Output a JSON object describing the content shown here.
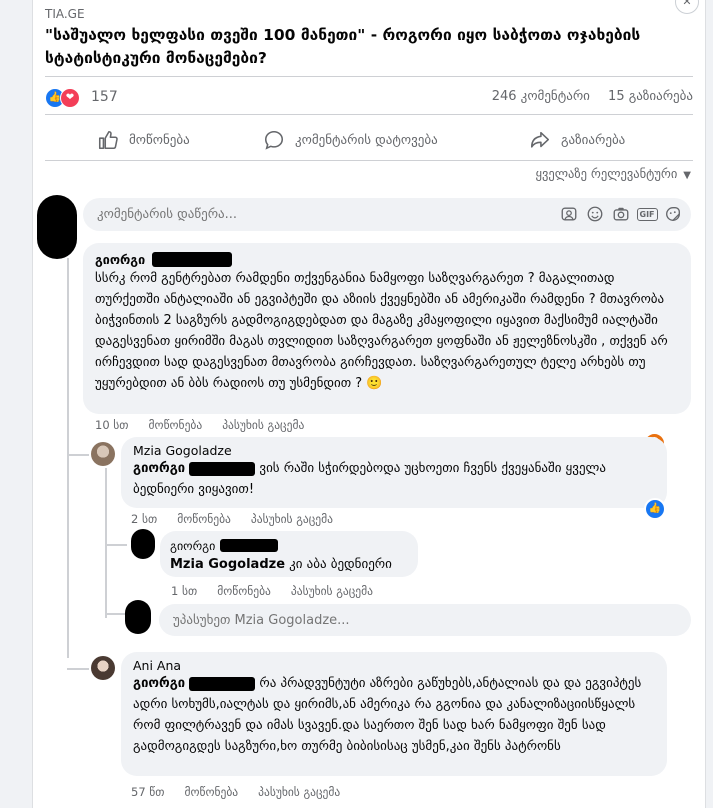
{
  "post": {
    "source": "TIA.GE",
    "title": "\"საშუალო ხელფასი თვეში 100 მანეთი\" - როგორი იყო საბჭოთა ოჯახების სტატისტიკური მონაცემები?",
    "reaction_count": "157",
    "comments_count": "246 კომენტარი",
    "shares_count": "15 გაზიარება"
  },
  "actions": {
    "like": "მოწონება",
    "comment": "კომენტარის დატოვება",
    "share": "გაზიარება"
  },
  "sort_label": "ყველაზე რელევანტური",
  "composer": {
    "placeholder": "კომენტარის დაწერა...",
    "gif": "GIF"
  },
  "comments": [
    {
      "author": "გიორგი",
      "text": "სსრკ რომ გენტრებათ რამდენი თქვენგანია ნამყოფი საზღვარგარეთ ? მაგალითად თურქეთში ანტალიაში ან ეგვიპტეში და აზიის ქვეყნებში ან ამერიკაში რამდენი ? მთავრობა ბიჭვინთის 2 საგზურს გადმოგიგდებდათ და მაგაზე კმაყოფილი იყავით მაქსიმუმ იალტაში დაგესვენათ ყირიმში მაგას თვლიდით საზღვარგარეთ ყოფნაში ან ჟელეზნოსკში , თქვენ არ ირჩევდით სად დაგესვენათ მთავრობა გირჩევდათ. საზღვარგარეთულ ტელე არხებს თუ უყურებდით ან ბბს რადიოს თუ უსმენდით ? 🙂",
      "time": "10 სთ",
      "like_label": "მოწონება",
      "reply_label": "პასუხის გაცემა",
      "reaction": "angry"
    },
    {
      "author": "Mzia Gogoladze",
      "mention": "გიორგი",
      "text": "ვის რაში სჭირდებოდა უცხოეთი ჩვენს ქვეყანაში ყველა ბედნიერი ვიყავით!",
      "time": "2 სთ",
      "like_label": "მოწონება",
      "reply_label": "პასუხის გაცემა",
      "reaction": "like"
    },
    {
      "author": "გიორგი",
      "mention": "Mzia Gogoladze",
      "text": "კი აბა ბედნიერი",
      "time": "1 სთ",
      "like_label": "მოწონება",
      "reply_label": "პასუხის გაცემა"
    },
    {
      "author": "Ani Ana",
      "mention": "გიორგი",
      "text": "რა პრადვუნტუტი აზრები გაწუხებს,ანტალიას და და ეგვიპტეს ადრი სოხუმს,იალტას და ყირიმს,ან ამერიკა რა გგონია და კანალიზაციისწყალს რომ ფილტრავენ და იმას სვავენ.და საერთო შენ სად ხარ ნამყოფი შენ სად გადმოგიგდეს საგზური,ხო თურმე ბიბისისაც უსმენ,კაი შენს პატრონს",
      "time": "57 წთ",
      "like_label": "მოწონება",
      "reply_label": "პასუხის გაცემა"
    }
  ],
  "reply_composer": {
    "placeholder": "უპასუხეთ Mzia Gogoladze..."
  },
  "colors": {
    "accent": "#1877f2",
    "love": "#f33e58",
    "angry": "#e9710f",
    "background": "#f0f2f5",
    "bubble": "#f0f2f5",
    "muted_text": "#65676b"
  }
}
